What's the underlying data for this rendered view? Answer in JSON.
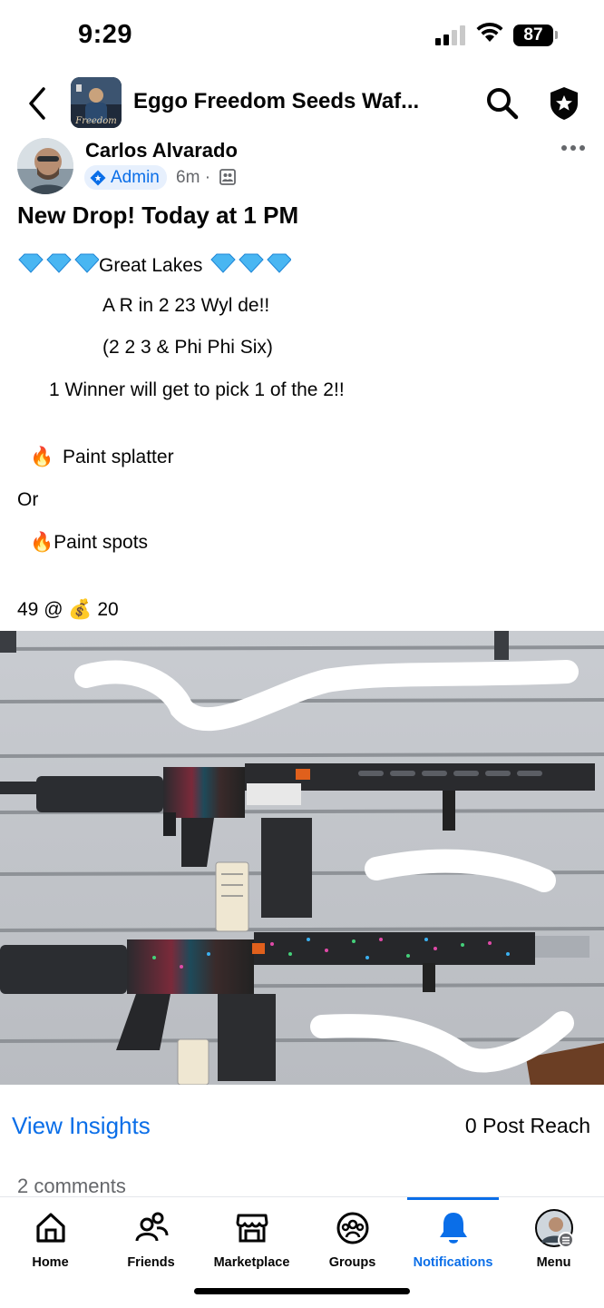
{
  "status_bar": {
    "time": "9:29",
    "battery": "87"
  },
  "header": {
    "group_title": "Eggo Freedom Seeds Waf...",
    "group_thumb_caption": "Freedom"
  },
  "post": {
    "author": "Carlos Alvarado",
    "role_badge": "Admin",
    "time": "6m",
    "separator": "·",
    "title": "New Drop! Today at 1 PM",
    "lines": {
      "great_lakes": "Great Lakes",
      "ar": "A R in 2 23 Wyl de!!",
      "calibers": "(2 2 3 & Phi Phi Six)",
      "winner": "1 Winner will get to pick 1 of the 2!!",
      "option1": "Paint splatter",
      "or": "Or",
      "option2": "Paint spots",
      "price_left": "49 @",
      "price_right": "20"
    },
    "emoji": {
      "fire": "🔥",
      "money_bag": "💰"
    }
  },
  "insights": {
    "link_label": "View Insights",
    "reach": "0 Post Reach",
    "comments": "2 comments"
  },
  "tab_bar": {
    "tabs": [
      {
        "label": "Home",
        "icon": "home-icon"
      },
      {
        "label": "Friends",
        "icon": "friends-icon"
      },
      {
        "label": "Marketplace",
        "icon": "marketplace-icon"
      },
      {
        "label": "Groups",
        "icon": "groups-icon"
      },
      {
        "label": "Notifications",
        "icon": "bell-icon",
        "active": true
      },
      {
        "label": "Menu",
        "icon": "avatar-menu-icon"
      }
    ]
  },
  "colors": {
    "accent": "#0a6ee8",
    "muted": "#65676b",
    "badge_bg": "#e7f0fd"
  }
}
